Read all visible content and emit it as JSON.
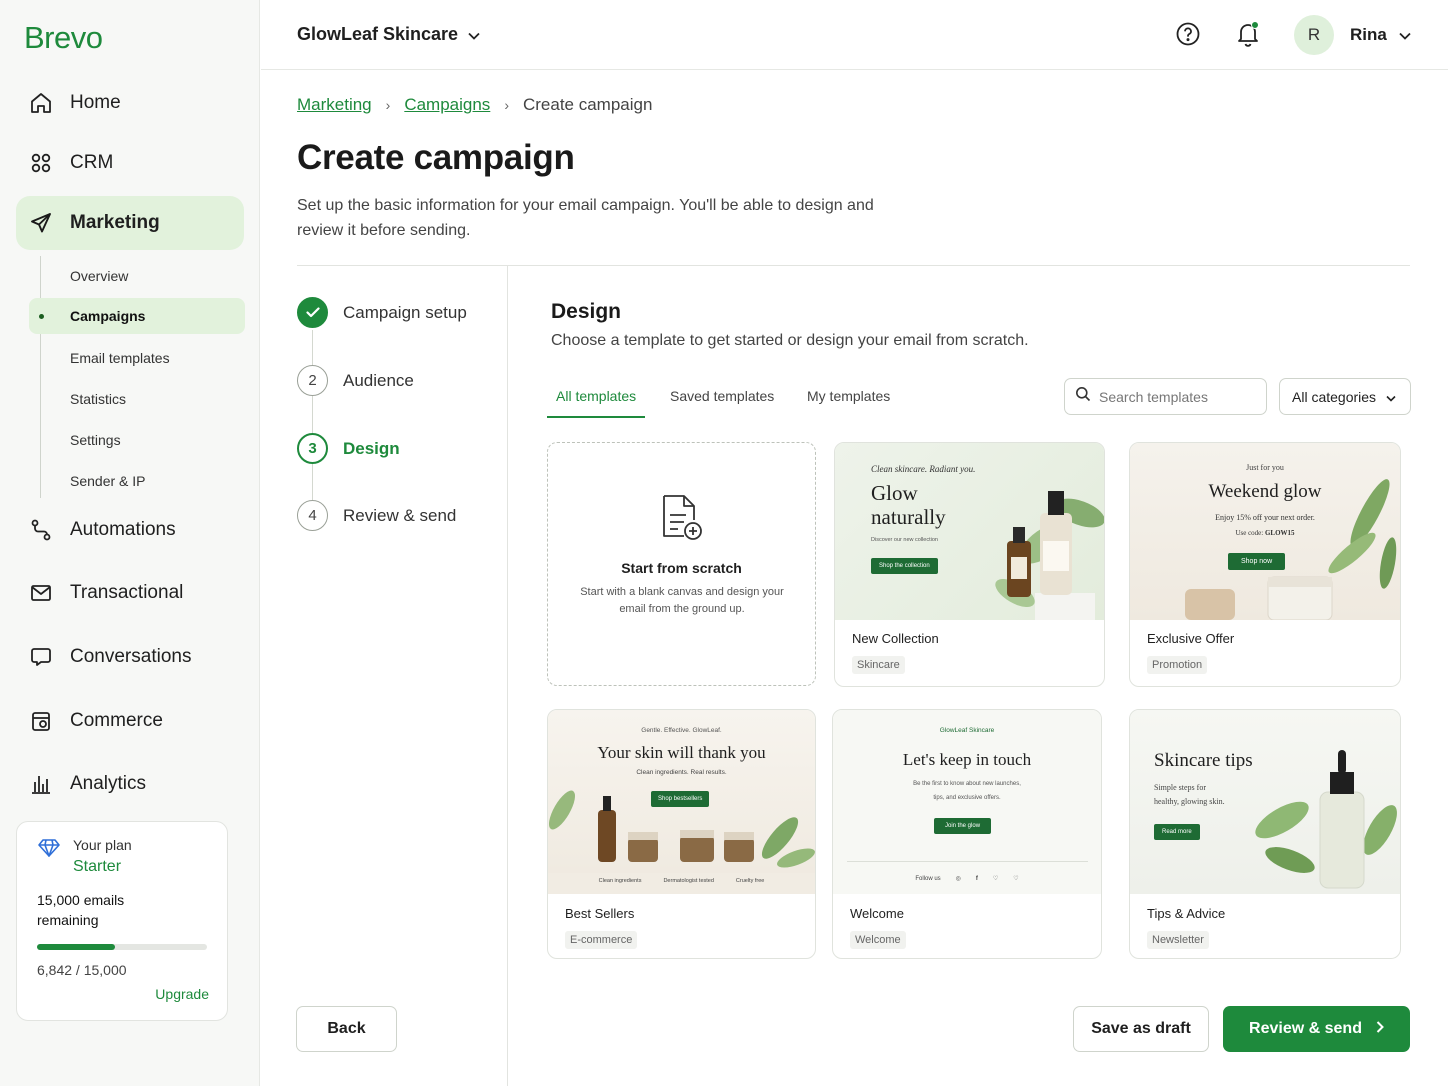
{
  "brand": {
    "logo": "Brevo",
    "accent": "#1e8a3c",
    "active_bg": "#e2f2dc"
  },
  "sidebar": {
    "items": [
      {
        "label": "Home",
        "icon": "home-icon"
      },
      {
        "label": "CRM",
        "icon": "users-icon"
      },
      {
        "label": "Marketing",
        "icon": "send-icon",
        "active": true
      },
      {
        "label": "Automations",
        "icon": "workflow-icon"
      },
      {
        "label": "Transactional",
        "icon": "mail-icon"
      },
      {
        "label": "Conversations",
        "icon": "chat-icon"
      },
      {
        "label": "Commerce",
        "icon": "store-icon"
      },
      {
        "label": "Analytics",
        "icon": "bar-chart-icon"
      }
    ],
    "subitems": [
      {
        "label": "Overview"
      },
      {
        "label": "Campaigns",
        "active": true
      },
      {
        "label": "Email templates"
      },
      {
        "label": "Statistics"
      },
      {
        "label": "Settings"
      },
      {
        "label": "Sender & IP"
      }
    ],
    "plan": {
      "label": "Your plan",
      "name": "Starter",
      "emails_count": "15,000",
      "emails_text": "emails remaining",
      "usage": "6,842 / 15,000",
      "usage_fraction": 0.456,
      "upgrade": "Upgrade",
      "icon": "diamond-icon"
    }
  },
  "topbar": {
    "workspace": "GlowLeaf Skincare",
    "user_initial": "R",
    "user_name": "Rina",
    "icons": [
      "help-icon",
      "bell-icon",
      "chevron-down-icon"
    ]
  },
  "breadcrumb": {
    "items": [
      "Marketing",
      "Campaigns"
    ],
    "current": "Create campaign"
  },
  "page": {
    "title": "Create campaign",
    "description": "Set up the basic information for your email campaign. You'll be able to design and review it before sending."
  },
  "steps": [
    {
      "num": "1",
      "label": "Campaign setup",
      "state": "done"
    },
    {
      "num": "2",
      "label": "Audience",
      "state": "todo"
    },
    {
      "num": "3",
      "label": "Design",
      "state": "current"
    },
    {
      "num": "4",
      "label": "Review & send",
      "state": "todo"
    }
  ],
  "design": {
    "title": "Design",
    "description": "Choose a template to get started or design your email from scratch.",
    "tabs": [
      "All templates",
      "Saved templates",
      "My templates"
    ],
    "search_placeholder": "Search templates",
    "category": "All categories",
    "scratch": {
      "title": "Start from scratch",
      "description": "Start with a blank canvas and design your email from the ground up."
    },
    "templates": [
      {
        "name": "New Collection",
        "tag": "Skincare",
        "kicker": "Clean skincare. Radiant you.",
        "headline1": "Glow",
        "headline2": "naturally",
        "sub": "Discover our new collection",
        "cta": "Shop the collection"
      },
      {
        "name": "Exclusive Offer",
        "tag": "Promotion",
        "kicker": "Just for you",
        "headline": "Weekend glow",
        "sub1": "Enjoy 15% off your next order.",
        "sub2": "Use code:",
        "code": "GLOW15",
        "cta": "Shop now"
      },
      {
        "name": "Best Sellers",
        "tag": "E-commerce",
        "kicker": "Gentle. Effective. GlowLeaf.",
        "headline": "Your skin will thank you",
        "sub": "Clean ingredients. Real results.",
        "cta": "Shop bestsellers",
        "footer": [
          "Clean ingredients",
          "Dermatologist tested",
          "Cruelty free"
        ]
      },
      {
        "name": "Welcome",
        "tag": "Welcome",
        "kicker": "GlowLeaf Skincare",
        "headline": "Let's keep in touch",
        "sub1": "Be the first to know about new launches,",
        "sub2": "tips, and exclusive offers.",
        "cta": "Join the glow",
        "follow": "Follow us"
      },
      {
        "name": "Tips & Advice",
        "tag": "Newsletter",
        "headline": "Skincare tips",
        "sub1": "Simple steps for",
        "sub2": "healthy, glowing skin.",
        "cta": "Read more"
      }
    ]
  },
  "actions": {
    "back": "Back",
    "draft": "Save as draft",
    "review": "Review & send"
  }
}
